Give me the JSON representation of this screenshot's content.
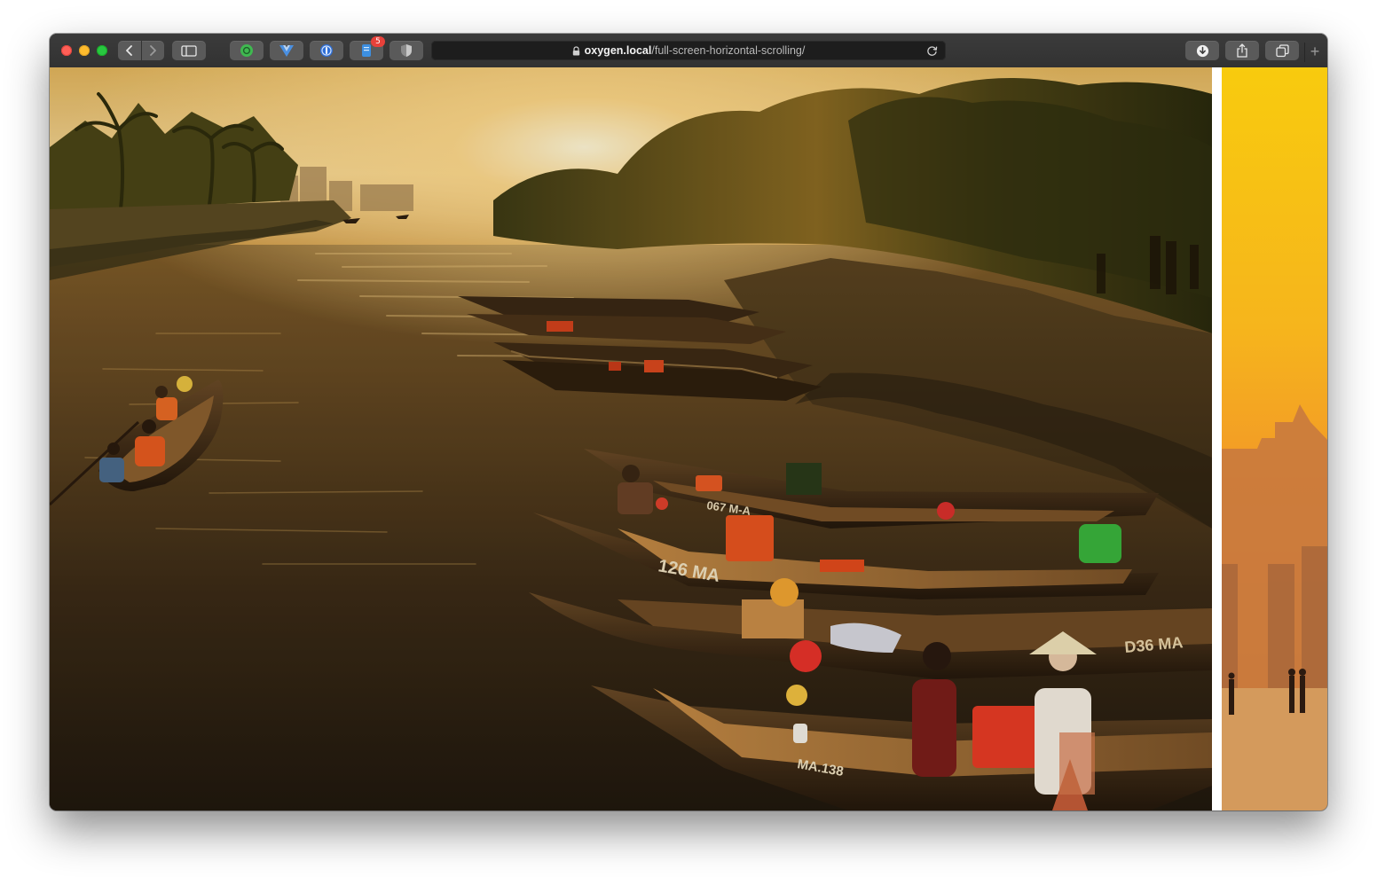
{
  "browser": {
    "address": {
      "host": "oxygen.local",
      "path": "/full-screen-horizontal-scrolling/"
    },
    "extensions": [
      {
        "icon": "green-circle-extension-icon"
      },
      {
        "icon": "vue-devtools-icon"
      },
      {
        "icon": "1password-icon"
      },
      {
        "icon": "notes-extension-icon",
        "badge": "5"
      },
      {
        "icon": "shield-extension-icon"
      }
    ],
    "toolbar_icons": [
      "back-icon",
      "forward-icon",
      "sidebar-icon",
      "lock-icon",
      "reload-icon",
      "download-icon",
      "share-icon",
      "tabs-overview-icon",
      "new-tab-icon"
    ]
  },
  "page": {
    "panels": [
      {
        "subject": "Sunset over a river with wooden rowing boats",
        "boat_numbers": [
          "126 MA",
          "MA.138",
          "D36 MA",
          "067 M-A"
        ]
      },
      {
        "subject": "City skyline at sunset, yellow-orange tint"
      }
    ]
  },
  "colors": {
    "titlebar": "#333333",
    "divider": "#ffffff",
    "panel_yellow": "#f6c21a"
  }
}
